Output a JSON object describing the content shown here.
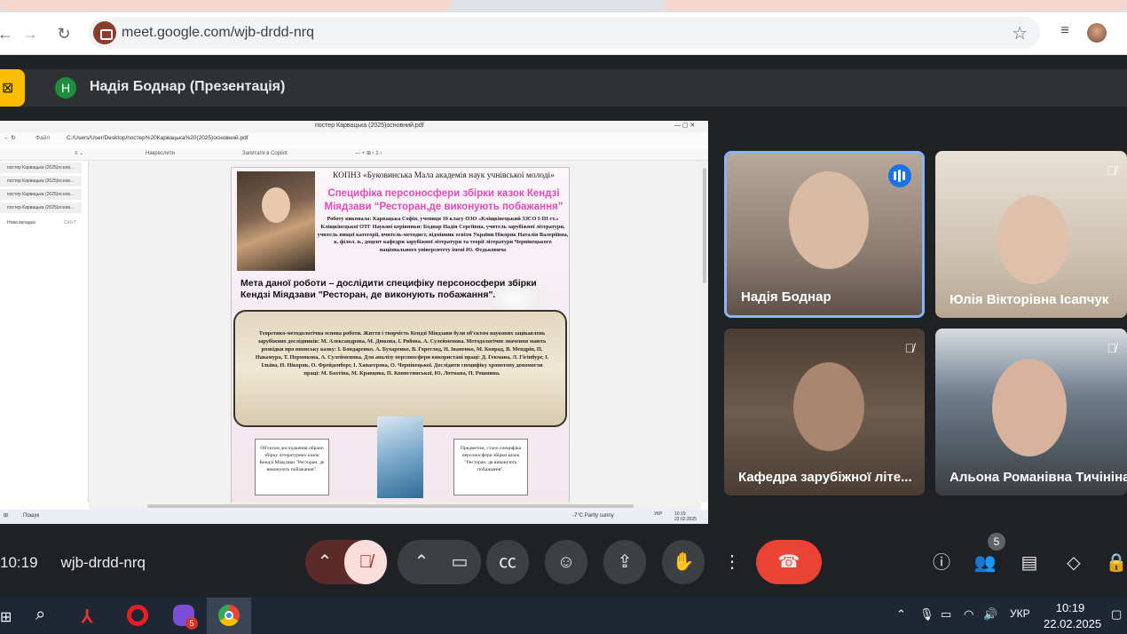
{
  "browser": {
    "url": "meet.google.com/wjb-drdd-nrq"
  },
  "presentation": {
    "avatar_letter": "Н",
    "title": "Надія Боднар (Презентація)"
  },
  "pdf_viewer": {
    "window_title": "постер Карвацька (2025)основний.pdf",
    "path": "C:/Users/User/Desktop/постер%20Карвацька%20(2025)основний.pdf",
    "file_label": "Файл",
    "draw_label": "Накреслити",
    "copilot_label": "Запитати в Copilot",
    "side_tabs": [
      "постер Карвацька (2025)основ...",
      "постер Карвацька (2025)основ...",
      "постер Карвацька (2025)основ...",
      "постер Карвацька (2025)основ..."
    ],
    "new_tab": "Нова вкладка",
    "new_tab_shortcut": "Ctrl+T"
  },
  "poster": {
    "org": "КОПНЗ «Буковинська Мала академія наук учнівської молоді»",
    "title": "Специфіка персоносфери збірки казок Кендзі Міядзави “Ресторан,де виконують побажання”",
    "authors": "Роботу виконала: Карвацька Софія, учениця 10 класу ОЗО «Кліщківецький ЗЗСО І-ІІІ ст.» Кліщківецької ОТГ Наукові керівники: Боднар Надія Сергіївна, учитель зарубіжної літератури, учитель вищої категорії, вчитель-методист, відмінник освіти України Нікоряк Наталія Валеріївна, к. філол. н., доцент кафедри зарубіжної літератури та теорії літератури Чернівецького національного університету імені Ю. Федьковича",
    "goal": "Мета даної роботи – дослідити специфіку персоносфери збірки Кендзі Міядзави \"Ресторан, де виконують побажання\".",
    "scroll_text": "Теоретико-методологічна основа роботи. Життя і творчість Кендзі Міядзави були об'єктом наукових зацікавлень зарубіжних дослідників: М. Александрова, М. Дюкова, І. Рябова, А. Сулейменова. Методологічне значення мають розвідки про японську казку: І. Бондаренко, А. Бухаренко, В. Горегляд, Н. Іваненко, М. Конрад, В. Мендрін, П. Накамура, Т. Пермякова, А. Сулейменова. Для аналізу персоносфери використані праці: Д. Гекмана, Л. Гігінбург, І. Ільїна, Н. Нікоряк, О. Фрейденберг, І. Хапагерова, О. Чернівецької. Дослідити специфіку хронотопу допомогли праці: М. Бахтіна, М. Кравцова, П. Копистинської, Ю. Лотмана, П. Рошнина.",
    "note_left": "Об'єктом дослідження обрано збірку літературних казок Кендзі Міядзави \"Ресторан, де виконують побажання\".",
    "note_right": "Предметом, стало специфіка персоносфери збірки казок \"Ресторан, де виконують побажання\"."
  },
  "taskbar_inner": {
    "search": "Пошук",
    "weather": "-7°C  Partly sunny",
    "lang": "УКР",
    "time": "10:19",
    "date": "22.02.2025"
  },
  "participants": [
    {
      "name": "Надія Боднар",
      "muted": false,
      "speaking": true
    },
    {
      "name": "Юлія Вікторівна Ісапчук",
      "muted": true,
      "speaking": false
    },
    {
      "name": "Кафедра зарубіжної літе...",
      "muted": true,
      "speaking": false
    },
    {
      "name": "Альона Романівна Тичініна",
      "muted": true,
      "speaking": false
    }
  ],
  "meeting": {
    "time": "10:19",
    "code": "wjb-drdd-nrq",
    "participant_count": "5"
  },
  "windows": {
    "lang": "УКР",
    "time": "10:19",
    "date": "22.02.2025",
    "viber_badge": "5"
  },
  "colors": {
    "end_call": "#ea4335",
    "mic_muted_bg": "#f9dedc",
    "present_stop": "#fbbc04",
    "accent_blue": "#8ab4f8"
  }
}
